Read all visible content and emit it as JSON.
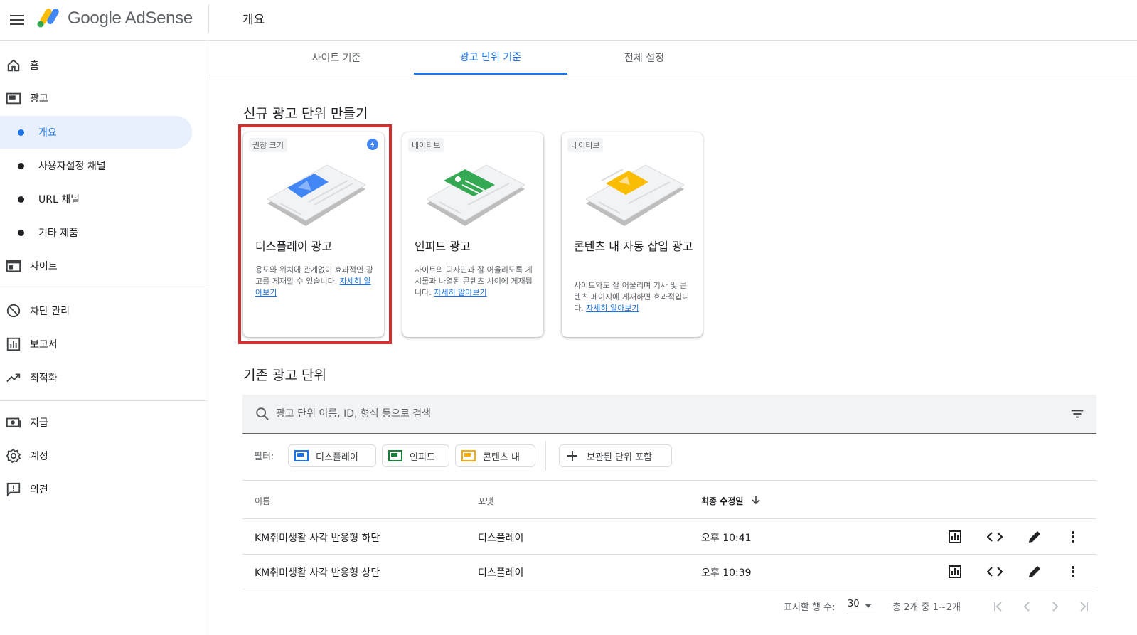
{
  "header": {
    "app_name": "Google AdSense",
    "page_title": "개요"
  },
  "sidebar": {
    "items": [
      {
        "label": "홈",
        "icon": "home-icon"
      },
      {
        "label": "광고",
        "icon": "ads-icon"
      },
      {
        "label": "개요",
        "active": true
      },
      {
        "label": "사용자설정 채널"
      },
      {
        "label": "URL 채널"
      },
      {
        "label": "기타 제품"
      },
      {
        "label": "사이트",
        "icon": "sites-icon"
      },
      {
        "label": "차단 관리",
        "icon": "block-icon"
      },
      {
        "label": "보고서",
        "icon": "report-icon"
      },
      {
        "label": "최적화",
        "icon": "trending-icon"
      },
      {
        "label": "지급",
        "icon": "payments-icon"
      },
      {
        "label": "계정",
        "icon": "gear-icon"
      },
      {
        "label": "의견",
        "icon": "feedback-icon"
      }
    ]
  },
  "tabs": [
    {
      "label": "사이트 기준"
    },
    {
      "label": "광고 단위 기준",
      "active": true
    },
    {
      "label": "전체 설정"
    }
  ],
  "new_units": {
    "title": "신규 광고 단위 만들기",
    "cards": [
      {
        "chip": "권장 크기",
        "title": "디스플레이 광고",
        "desc": "용도와 위치에 관계없이 효과적인 광고를 게재할 수 있습니다.",
        "link": "자세히 알아보기",
        "color": "#4285f4"
      },
      {
        "chip": "네이티브",
        "title": "인피드 광고",
        "desc": "사이트의 디자인과 잘 어울리도록 게시물과 나열된 콘텐츠 사이에 게재됩니다.",
        "link": "자세히 알아보기",
        "color": "#34a853"
      },
      {
        "chip": "네이티브",
        "title": "콘텐츠 내 자동 삽입 광고",
        "desc": "사이트와도 잘 어울리며 기사 및 콘텐츠 페이지에 게재하면 효과적입니다.",
        "link": "자세히 알아보기",
        "color": "#fbbc04"
      }
    ]
  },
  "existing_units": {
    "title": "기존 광고 단위",
    "search_placeholder": "광고 단위 이름, ID, 형식 등으로 검색",
    "filter_label": "필터:",
    "filters": [
      {
        "label": "디스플레이",
        "color": "#1a73e8"
      },
      {
        "label": "인피드",
        "color": "#188038"
      },
      {
        "label": "콘텐츠 내",
        "color": "#f9ab00"
      }
    ],
    "archived_label": "보관된 단위 포함",
    "columns": [
      "이름",
      "포맷",
      "최종 수정일"
    ],
    "rows": [
      {
        "name": "KM취미생활 사각 반응형 하단",
        "format": "디스플레이",
        "modified": "오후 10:41"
      },
      {
        "name": "KM취미생활 사각 반응형 상단",
        "format": "디스플레이",
        "modified": "오후 10:39"
      }
    ],
    "pagination": {
      "rows_label": "표시할 행 수:",
      "rows_value": "30",
      "range": "총 2개 중 1~2개"
    }
  }
}
